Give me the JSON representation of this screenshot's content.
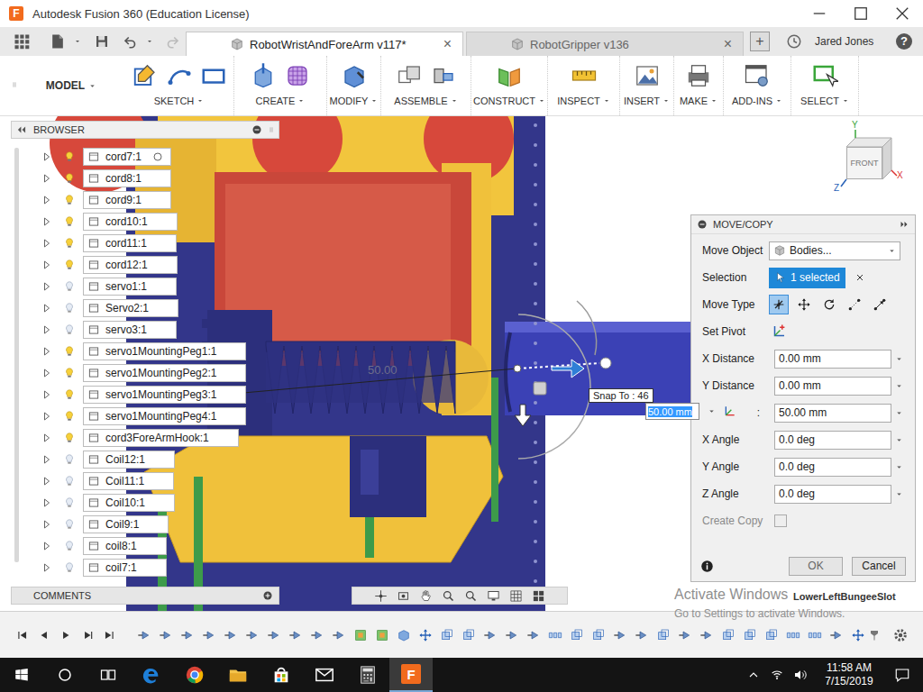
{
  "window": {
    "title": "Autodesk Fusion 360 (Education License)",
    "logo": "F"
  },
  "tabs": [
    {
      "label": "RobotWristAndForeArm v117*",
      "selected": true,
      "close": "×"
    },
    {
      "label": "RobotGripper v136",
      "selected": false,
      "close": "×"
    }
  ],
  "new_tab": "+",
  "user": "Jared Jones",
  "help": "?",
  "workspace": "MODEL",
  "toolbar": [
    {
      "label": "SKETCH",
      "tools": [
        {
          "kind": "sketch"
        },
        {
          "kind": "arc"
        },
        {
          "kind": "rect"
        }
      ]
    },
    {
      "label": "CREATE",
      "tools": [
        {
          "kind": "extrude"
        },
        {
          "kind": "form"
        }
      ]
    },
    {
      "label": "MODIFY",
      "tools": [
        {
          "kind": "presspull"
        }
      ]
    },
    {
      "label": "ASSEMBLE",
      "tools": [
        {
          "kind": "component"
        },
        {
          "kind": "joint"
        }
      ]
    },
    {
      "label": "CONSTRUCT",
      "tools": [
        {
          "kind": "plane"
        }
      ]
    },
    {
      "label": "INSPECT",
      "tools": [
        {
          "kind": "measure"
        }
      ]
    },
    {
      "label": "INSERT",
      "tools": [
        {
          "kind": "image"
        }
      ]
    },
    {
      "label": "MAKE",
      "tools": [
        {
          "kind": "print"
        }
      ]
    },
    {
      "label": "ADD-INS",
      "tools": [
        {
          "kind": "scripts"
        }
      ]
    },
    {
      "label": "SELECT",
      "tools": [
        {
          "kind": "select"
        }
      ]
    }
  ],
  "browser": {
    "title": "BROWSER",
    "items": [
      {
        "label": "cord7:1",
        "visible": true,
        "show_radio": true
      },
      {
        "label": "cord8:1",
        "visible": true,
        "show_radio": false
      },
      {
        "label": "cord9:1",
        "visible": true,
        "show_radio": false
      },
      {
        "label": "cord10:1",
        "visible": true,
        "show_radio": false
      },
      {
        "label": "cord11:1",
        "visible": true,
        "show_radio": false
      },
      {
        "label": "cord12:1",
        "visible": true,
        "show_radio": false
      },
      {
        "label": "servo1:1",
        "visible": false,
        "show_radio": false
      },
      {
        "label": "Servo2:1",
        "visible": false,
        "show_radio": false
      },
      {
        "label": "servo3:1",
        "visible": false,
        "show_radio": false
      },
      {
        "label": "servo1MountingPeg1:1",
        "visible": true,
        "show_radio": false
      },
      {
        "label": "servo1MountingPeg2:1",
        "visible": true,
        "show_radio": false
      },
      {
        "label": "servo1MountingPeg3:1",
        "visible": true,
        "show_radio": false
      },
      {
        "label": "servo1MountingPeg4:1",
        "visible": true,
        "show_radio": false
      },
      {
        "label": "cord3ForeArmHook:1",
        "visible": true,
        "show_radio": false
      },
      {
        "label": "Coil12:1",
        "visible": false,
        "show_radio": false
      },
      {
        "label": "Coil11:1",
        "visible": false,
        "show_radio": false
      },
      {
        "label": "Coil10:1",
        "visible": false,
        "show_radio": false
      },
      {
        "label": "Coil9:1",
        "visible": false,
        "show_radio": false
      },
      {
        "label": "coil8:1",
        "visible": false,
        "show_radio": false
      },
      {
        "label": "coil7:1",
        "visible": false,
        "show_radio": false
      }
    ]
  },
  "comments": {
    "title": "COMMENTS"
  },
  "navbar": [
    {
      "kind": "orbit"
    },
    {
      "kind": "look"
    },
    {
      "kind": "pan"
    },
    {
      "kind": "zoom"
    },
    {
      "kind": "zoom"
    },
    {
      "kind": "display"
    },
    {
      "kind": "grid"
    },
    {
      "kind": "viewports"
    }
  ],
  "viewport": {
    "dimension": "50.00",
    "snap_tooltip": "Snap To : 46",
    "distance_input": "50.00 mm",
    "hover_label": "LowerLeftBungeeSlot",
    "view_cube": "FRONT",
    "axes": [
      "Y",
      "X",
      "Z"
    ],
    "watermark": {
      "title": "Activate Windows",
      "subtitle": "Go to Settings to activate Windows."
    }
  },
  "dialog": {
    "title": "MOVE/COPY",
    "move_object": {
      "label": "Move Object",
      "value": "Bodies..."
    },
    "selection": {
      "label": "Selection",
      "value": "1 selected"
    },
    "move_type": {
      "label": "Move Type",
      "options": [
        {
          "kind": "free",
          "selected": true
        },
        {
          "kind": "translate",
          "selected": false
        },
        {
          "kind": "rotate",
          "selected": false
        },
        {
          "kind": "point",
          "selected": false
        },
        {
          "kind": "pointtopoint",
          "selected": false
        }
      ]
    },
    "set_pivot": {
      "label": "Set Pivot"
    },
    "fields": [
      {
        "label": "X Distance",
        "value": "0.00 mm"
      },
      {
        "label": "Y Distance",
        "value": "0.00 mm"
      },
      {
        "label": ":",
        "value": "50.00 mm"
      },
      {
        "label": "X Angle",
        "value": "0.0 deg"
      },
      {
        "label": "Y Angle",
        "value": "0.0 deg"
      },
      {
        "label": "Z Angle",
        "value": "0.0 deg"
      }
    ],
    "create_copy": {
      "label": "Create Copy",
      "checked": false,
      "disabled": true
    },
    "buttons": [
      {
        "label": "OK"
      },
      {
        "label": "Cancel"
      }
    ]
  },
  "timeline": {
    "features": [
      {
        "kind": "joint"
      },
      {
        "kind": "joint"
      },
      {
        "kind": "joint"
      },
      {
        "kind": "joint"
      },
      {
        "kind": "joint"
      },
      {
        "kind": "joint"
      },
      {
        "kind": "joint"
      },
      {
        "kind": "joint"
      },
      {
        "kind": "joint"
      },
      {
        "kind": "joint"
      },
      {
        "kind": "sketch"
      },
      {
        "kind": "sketch"
      },
      {
        "kind": "body"
      },
      {
        "kind": "move"
      },
      {
        "kind": "component"
      },
      {
        "kind": "component"
      },
      {
        "kind": "joint"
      },
      {
        "kind": "joint"
      },
      {
        "kind": "joint"
      },
      {
        "kind": "pattern"
      },
      {
        "kind": "component"
      },
      {
        "kind": "component"
      },
      {
        "kind": "joint"
      },
      {
        "kind": "joint"
      },
      {
        "kind": "component"
      },
      {
        "kind": "joint"
      },
      {
        "kind": "joint"
      },
      {
        "kind": "component"
      },
      {
        "kind": "component"
      },
      {
        "kind": "component"
      },
      {
        "kind": "pattern"
      },
      {
        "kind": "pattern"
      },
      {
        "kind": "joint"
      },
      {
        "kind": "move"
      }
    ]
  },
  "taskbar": {
    "apps": [
      {
        "kind": "edge",
        "active": false
      },
      {
        "kind": "chrome",
        "active": false
      },
      {
        "kind": "folder",
        "active": false
      },
      {
        "kind": "store",
        "active": false
      },
      {
        "kind": "mail",
        "active": false
      },
      {
        "kind": "calc",
        "active": false
      },
      {
        "kind": "fusion",
        "active": true
      }
    ],
    "time": "11:58 AM",
    "date": "7/15/2019"
  }
}
